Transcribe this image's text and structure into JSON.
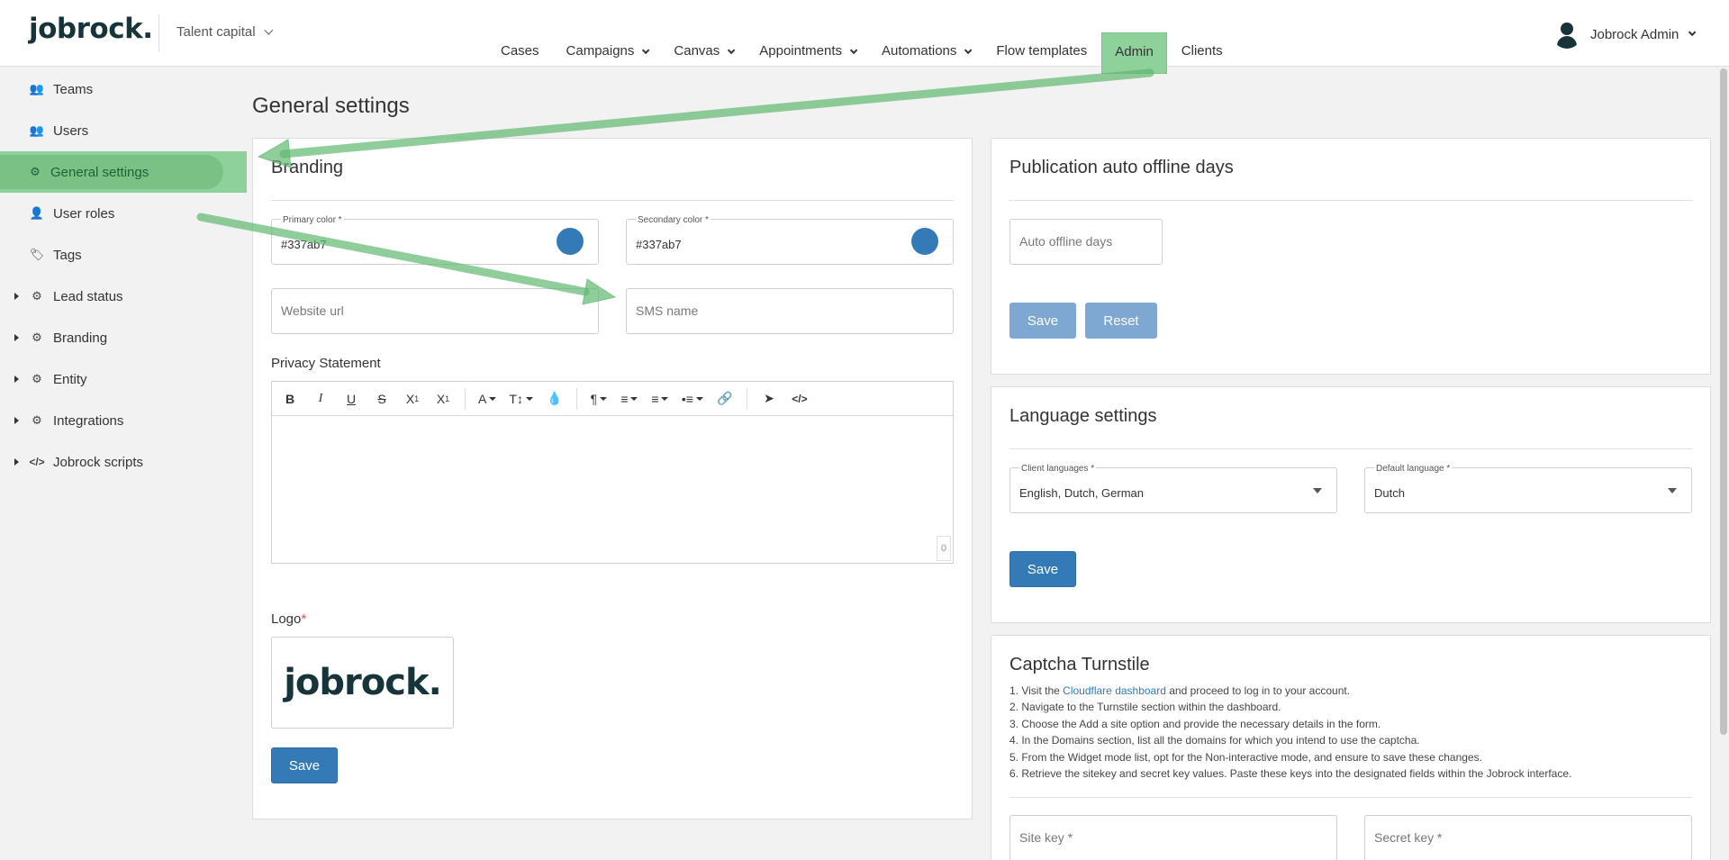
{
  "header": {
    "logo": "jobrock.",
    "tenant": "Talent capital",
    "nav": [
      {
        "label": "Cases",
        "dropdown": false
      },
      {
        "label": "Campaigns",
        "dropdown": true
      },
      {
        "label": "Canvas",
        "dropdown": true
      },
      {
        "label": "Appointments",
        "dropdown": true
      },
      {
        "label": "Automations",
        "dropdown": true
      },
      {
        "label": "Flow templates",
        "dropdown": false
      },
      {
        "label": "Admin",
        "dropdown": false,
        "active": true
      },
      {
        "label": "Clients",
        "dropdown": false
      }
    ],
    "user": "Jobrock Admin"
  },
  "sidebar": {
    "items": [
      {
        "label": "Teams",
        "icon": "users-icon"
      },
      {
        "label": "Users",
        "icon": "users-group-icon"
      },
      {
        "label": "General settings",
        "icon": "gear-icon",
        "active": true
      },
      {
        "label": "User roles",
        "icon": "user-gear-icon"
      },
      {
        "label": "Tags",
        "icon": "tags-icon"
      },
      {
        "label": "Lead status",
        "icon": "gears-icon",
        "expandable": true
      },
      {
        "label": "Branding",
        "icon": "gears-icon",
        "expandable": true
      },
      {
        "label": "Entity",
        "icon": "gears-icon",
        "expandable": true
      },
      {
        "label": "Integrations",
        "icon": "gears-icon",
        "expandable": true
      },
      {
        "label": "Jobrock scripts",
        "icon": "code-icon",
        "expandable": true
      }
    ]
  },
  "main": {
    "title": "General settings",
    "branding": {
      "title": "Branding",
      "primary_label": "Primary color *",
      "primary_value": "#337ab7",
      "secondary_label": "Secondary color *",
      "secondary_value": "#337ab7",
      "website_placeholder": "Website url",
      "sms_placeholder": "SMS name",
      "privacy_label": "Privacy Statement",
      "toolbar": [
        "B",
        "I",
        "U",
        "S",
        "X₁",
        "X¹",
        "A",
        "T↕",
        "drop",
        "¶",
        "align",
        "ol",
        "ul",
        "link",
        "pointer",
        "</>"
      ],
      "char_count": "0",
      "logo_label": "Logo",
      "logo_required": "*",
      "logo_image_text": "jobrock.",
      "save": "Save"
    },
    "publication": {
      "title": "Publication auto offline days",
      "placeholder": "Auto offline days",
      "save": "Save",
      "reset": "Reset"
    },
    "language": {
      "title": "Language settings",
      "client_label": "Client languages *",
      "client_value": "English, Dutch, German",
      "default_label": "Default language *",
      "default_value": "Dutch",
      "save": "Save"
    },
    "captcha": {
      "title": "Captcha Turnstile",
      "step1_pre": "1. Visit the ",
      "step1_link": "Cloudflare dashboard",
      "step1_post": " and proceed to log in to your account.",
      "steps": [
        "2. Navigate to the Turnstile section within the dashboard.",
        "3. Choose the Add a site option and provide the necessary details in the form.",
        "4. In the Domains section, list all the domains for which you intend to use the captcha.",
        "5. From the Widget mode list, opt for the Non-interactive mode, and ensure to save these changes.",
        "6. Retrieve the sitekey and secret key values. Paste these keys into the designated fields within the Jobrock interface."
      ],
      "site_key_placeholder": "Site key *",
      "secret_key_placeholder": "Secret key *"
    }
  },
  "colors": {
    "brand_dark": "#16343a",
    "primary_blue": "#337ab7",
    "highlight_green": "#8fd19a"
  }
}
